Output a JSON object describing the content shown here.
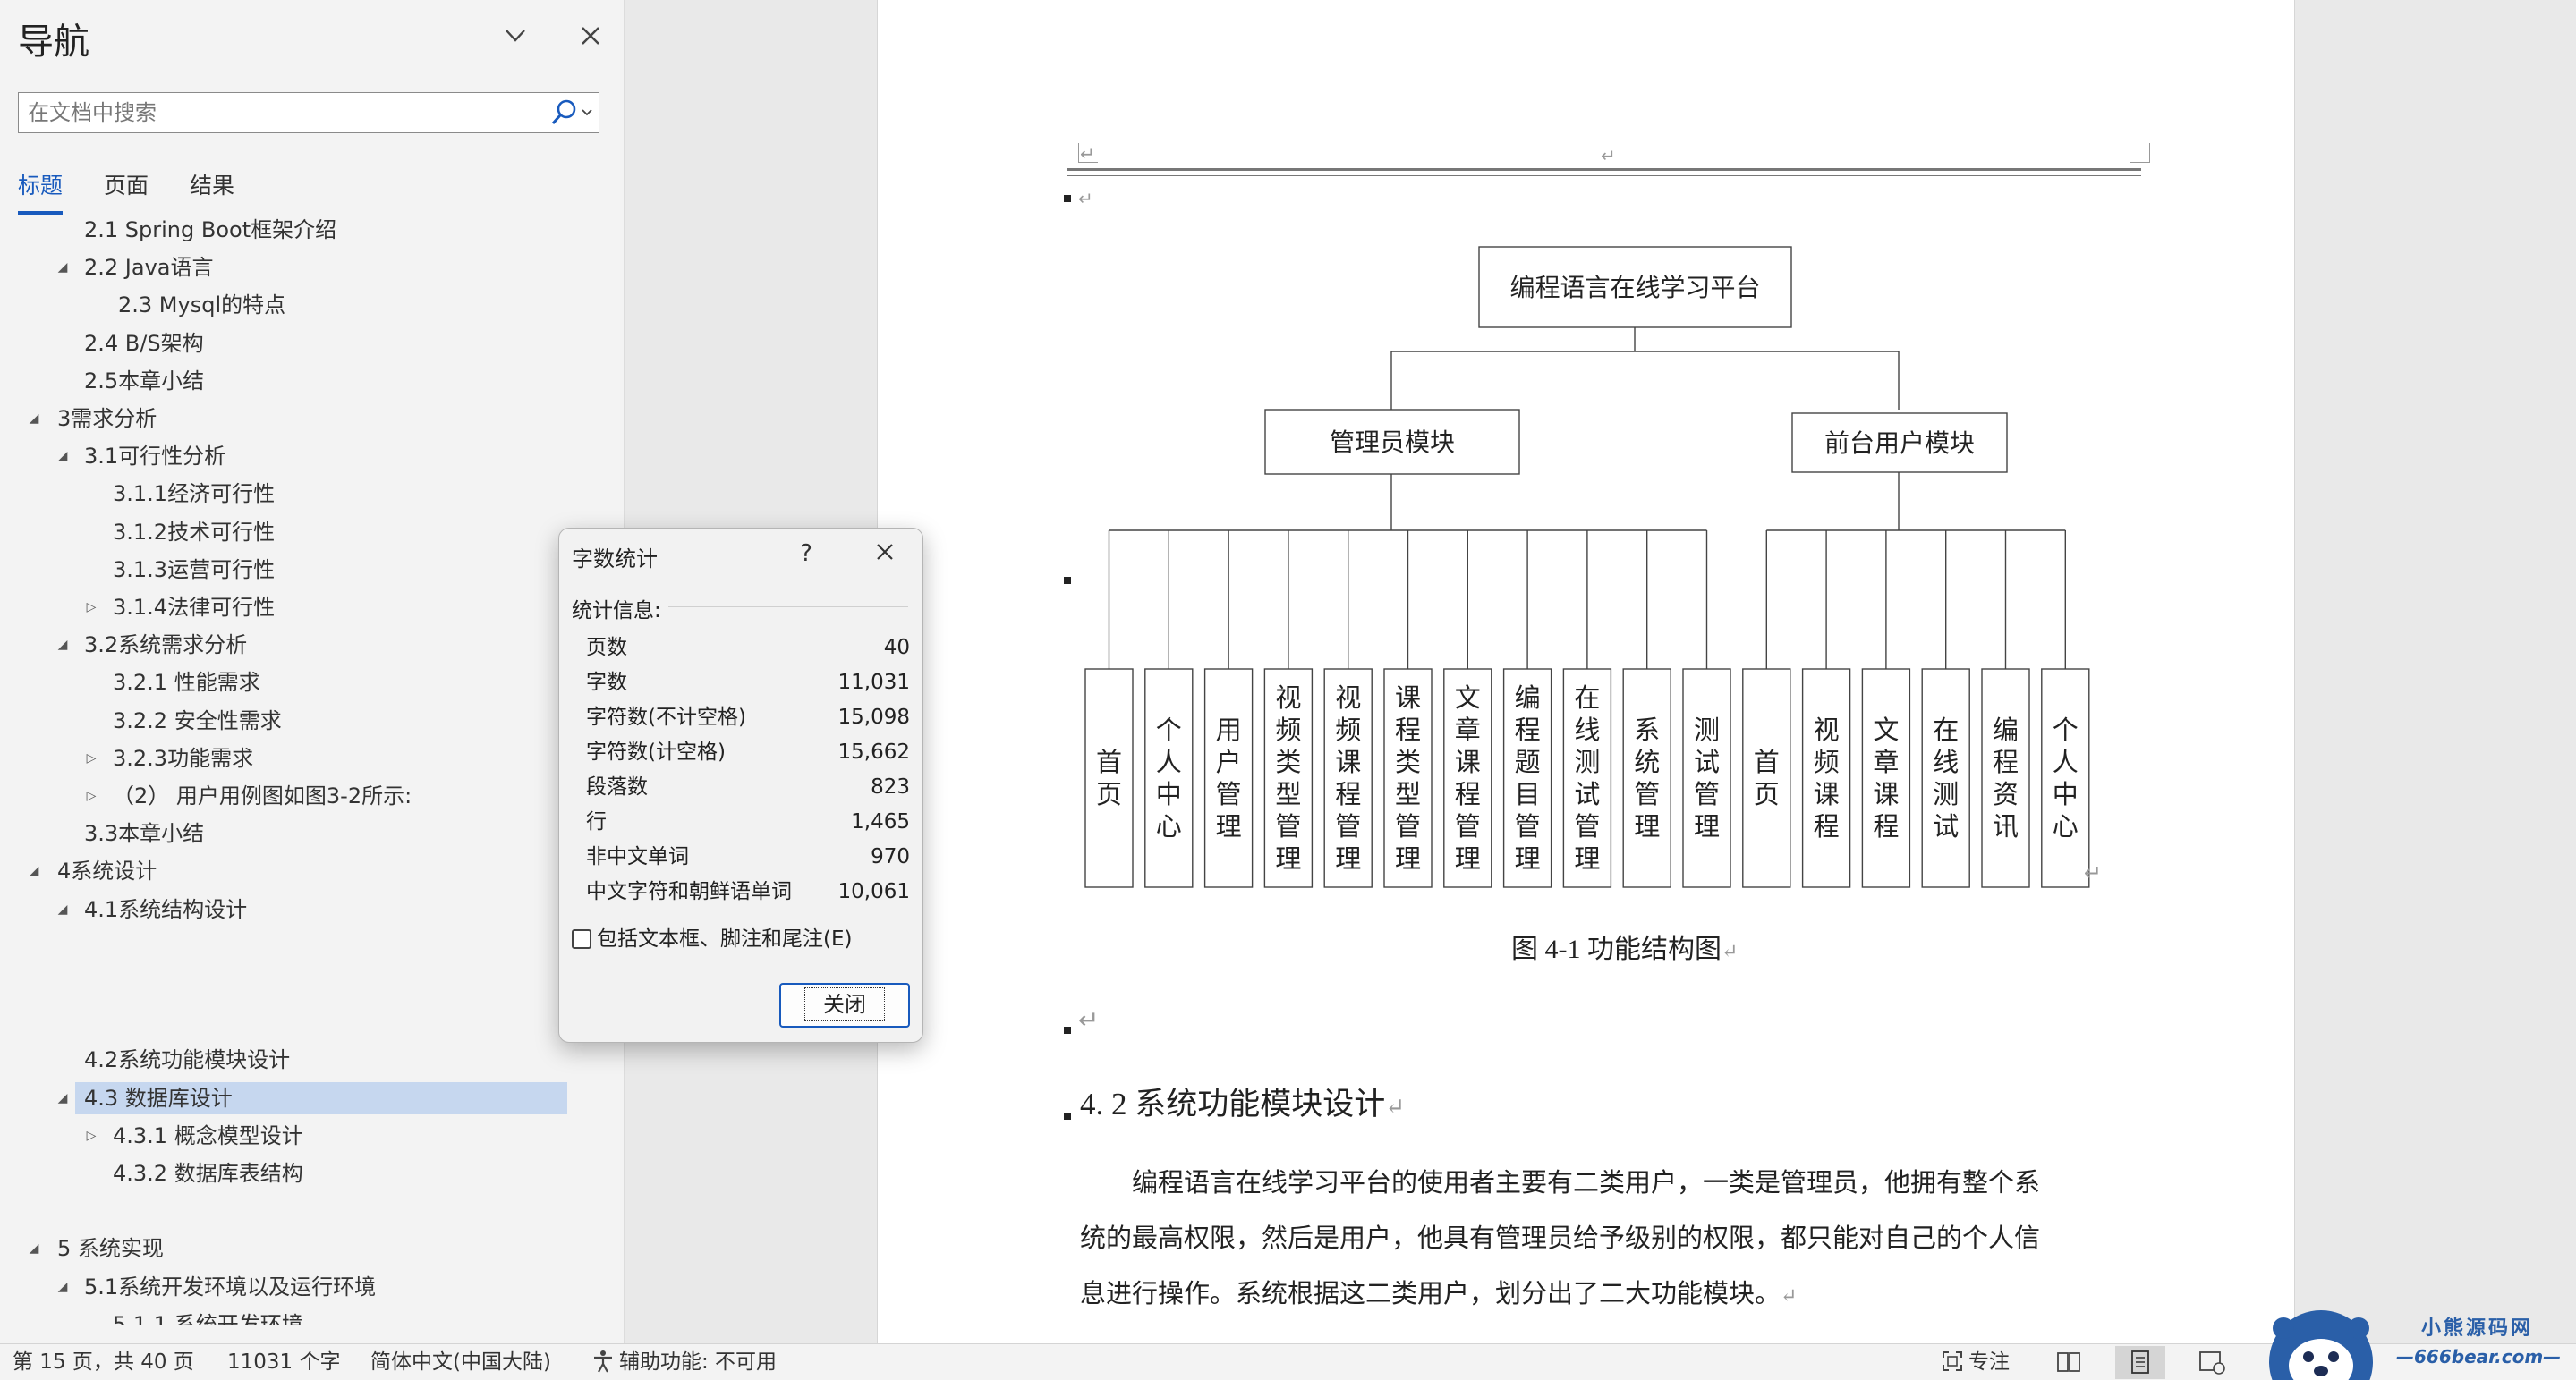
{
  "nav": {
    "title": "导航",
    "search_placeholder": "在文档中搜索",
    "tabs": [
      {
        "label": "标题",
        "active": true
      },
      {
        "label": "页面",
        "active": false
      },
      {
        "label": "结果",
        "active": false
      }
    ],
    "headings": [
      {
        "label": "2.1 Spring Boot框架介绍",
        "level": 2,
        "arrow": ""
      },
      {
        "label": "2.2 Java语言",
        "level": 2,
        "arrow": "expanded"
      },
      {
        "label": "2.3 Mysql的特点",
        "level": 4,
        "arrow": ""
      },
      {
        "label": "2.4 B/S架构",
        "level": 2,
        "arrow": ""
      },
      {
        "label": "2.5本章小结",
        "level": 2,
        "arrow": ""
      },
      {
        "label": "3需求分析",
        "level": 1,
        "arrow": "expanded"
      },
      {
        "label": "3.1可行性分析",
        "level": 2,
        "arrow": "expanded"
      },
      {
        "label": "3.1.1经济可行性",
        "level": 3,
        "arrow": ""
      },
      {
        "label": "3.1.2技术可行性",
        "level": 3,
        "arrow": ""
      },
      {
        "label": "3.1.3运营可行性",
        "level": 3,
        "arrow": ""
      },
      {
        "label": "3.1.4法律可行性",
        "level": 3,
        "arrow": "collapsed"
      },
      {
        "label": "3.2系统需求分析",
        "level": 2,
        "arrow": "expanded"
      },
      {
        "label": "3.2.1 性能需求",
        "level": 3,
        "arrow": ""
      },
      {
        "label": "3.2.2 安全性需求",
        "level": 3,
        "arrow": ""
      },
      {
        "label": "3.2.3功能需求",
        "level": 3,
        "arrow": "collapsed"
      },
      {
        "label": "（2） 用户用例图如图3-2所示:",
        "level": 3,
        "arrow": "collapsed"
      },
      {
        "label": "3.3本章小结",
        "level": 2,
        "arrow": ""
      },
      {
        "label": "4系统设计",
        "level": 1,
        "arrow": "expanded"
      },
      {
        "label": "4.1系统结构设计",
        "level": 2,
        "arrow": "expanded"
      },
      {
        "label": "",
        "level": 3,
        "arrow": ""
      },
      {
        "label": "",
        "level": 3,
        "arrow": ""
      },
      {
        "label": "",
        "level": 3,
        "arrow": ""
      },
      {
        "label": "4.2系统功能模块设计",
        "level": 2,
        "arrow": ""
      },
      {
        "label": "4.3 数据库设计",
        "level": 2,
        "arrow": "expanded",
        "selected": true
      },
      {
        "label": "4.3.1 概念模型设计",
        "level": 3,
        "arrow": "collapsed"
      },
      {
        "label": "4.3.2 数据库表结构",
        "level": 3,
        "arrow": ""
      },
      {
        "label": "",
        "level": 3,
        "arrow": ""
      },
      {
        "label": "5 系统实现",
        "level": 1,
        "arrow": "expanded"
      },
      {
        "label": "5.1系统开发环境以及运行环境",
        "level": 2,
        "arrow": "expanded"
      },
      {
        "label": "5.1.1 系统开发环境",
        "level": 3,
        "arrow": ""
      }
    ]
  },
  "doc": {
    "header_mark": "↵",
    "chart_root": "编程语言在线学习平台",
    "admin_module": "管理员模块",
    "front_module": "前台用户模块",
    "admin_leaves": [
      "首页",
      "个人中心",
      "用户管理",
      "视频类型管理",
      "视频课程管理",
      "课程类型管理",
      "文章课程管理",
      "编程题目管理",
      "在线测试管理",
      "系统管理",
      "测试管理"
    ],
    "front_leaves": [
      "首页",
      "视频课程",
      "文章课程",
      "在线测试",
      "编程资讯",
      "个人中心"
    ],
    "caption": "图 4-1 功能结构图",
    "section_heading": "4. 2 系统功能模块设计",
    "body_lines": [
      "编程语言在线学习平台的使用者主要有二类用户，一类是管理员，他拥有整个系",
      "统的最高权限，然后是用户，他具有管理员给予级别的权限，都只能对自己的个人信",
      "息进行操作。系统根据这二类用户，划分出了二大功能模块。"
    ]
  },
  "dialog": {
    "title": "字数统计",
    "help": "?",
    "section_label": "统计信息:",
    "stats": [
      {
        "label": "页数",
        "value": "40"
      },
      {
        "label": "字数",
        "value": "11,031"
      },
      {
        "label": "字符数(不计空格)",
        "value": "15,098"
      },
      {
        "label": "字符数(计空格)",
        "value": "15,662"
      },
      {
        "label": "段落数",
        "value": "823"
      },
      {
        "label": "行",
        "value": "1,465"
      },
      {
        "label": "非中文单词",
        "value": "970"
      },
      {
        "label": "中文字符和朝鲜语单词",
        "value": "10,061"
      }
    ],
    "checkbox_label": "包括文本框、脚注和尾注(E)",
    "checkbox_checked": false,
    "close_label": "关闭"
  },
  "status": {
    "page": "第 15 页，共 40 页",
    "words": "11031 个字",
    "language": "简体中文(中国大陆)",
    "accessibility": "辅助功能: 不可用",
    "focus": "专注"
  },
  "watermark": {
    "brand": "小熊源码网",
    "url": "—666bear.com—"
  },
  "colors": {
    "accent": "#185abd",
    "selected_heading": "#c6d7ef",
    "watermark_blue": "#2a5fa8"
  }
}
